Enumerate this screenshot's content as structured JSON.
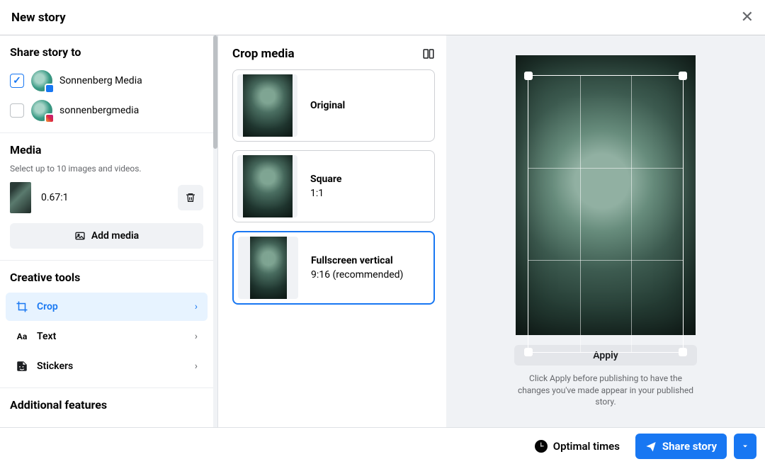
{
  "header": {
    "title": "New story"
  },
  "share": {
    "title": "Share story to",
    "accounts": [
      {
        "name": "Sonnenberg Media",
        "checked": true,
        "network": "facebook"
      },
      {
        "name": "sonnenbergmedia",
        "checked": false,
        "network": "instagram"
      }
    ]
  },
  "media": {
    "title": "Media",
    "subtitle": "Select up to 10 images and videos.",
    "items": [
      {
        "ratio": "0.67:1"
      }
    ],
    "add_label": "Add media"
  },
  "tools": {
    "title": "Creative tools",
    "items": [
      {
        "id": "crop",
        "label": "Crop",
        "active": true
      },
      {
        "id": "text",
        "label": "Text",
        "active": false
      },
      {
        "id": "stickers",
        "label": "Stickers",
        "active": false
      }
    ]
  },
  "additional": {
    "title": "Additional features"
  },
  "crop": {
    "title": "Crop media",
    "options": [
      {
        "name": "Original",
        "sub": ""
      },
      {
        "name": "Square",
        "sub": "1:1"
      },
      {
        "name": "Fullscreen vertical",
        "sub": "9:16 (recommended)",
        "selected": true
      }
    ],
    "apply_label": "Apply",
    "apply_hint": "Click Apply before publishing to have the changes you've made appear in your published story."
  },
  "footer": {
    "optimal_label": "Optimal times",
    "share_label": "Share story"
  }
}
